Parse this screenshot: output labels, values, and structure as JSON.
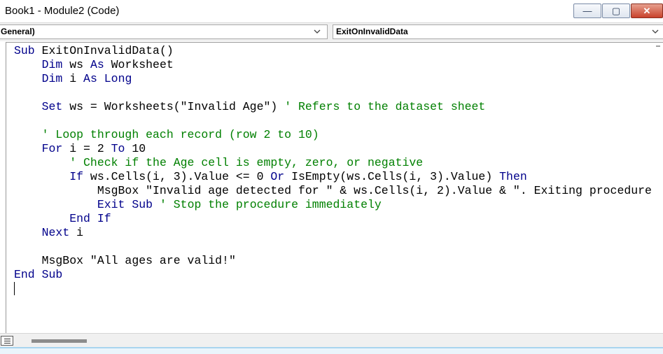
{
  "window": {
    "title": "Book1 - Module2 (Code)",
    "minimize_glyph": "—",
    "maximize_glyph": "▢",
    "close_glyph": "✕"
  },
  "object_combo": {
    "value": "(General)",
    "visible_text": "General)"
  },
  "procedure_combo": {
    "value": "ExitOnInvalidData"
  },
  "code_lines": [
    [
      {
        "t": "Sub",
        "c": "kw"
      },
      {
        "t": " ExitOnInvalidData()",
        "c": ""
      }
    ],
    [
      {
        "t": "    ",
        "c": ""
      },
      {
        "t": "Dim",
        "c": "kw"
      },
      {
        "t": " ws ",
        "c": ""
      },
      {
        "t": "As",
        "c": "kw"
      },
      {
        "t": " Worksheet",
        "c": ""
      }
    ],
    [
      {
        "t": "    ",
        "c": ""
      },
      {
        "t": "Dim",
        "c": "kw"
      },
      {
        "t": " i ",
        "c": ""
      },
      {
        "t": "As",
        "c": "kw"
      },
      {
        "t": " ",
        "c": ""
      },
      {
        "t": "Long",
        "c": "kw"
      }
    ],
    [],
    [
      {
        "t": "    ",
        "c": ""
      },
      {
        "t": "Set",
        "c": "kw"
      },
      {
        "t": " ws = Worksheets(\"Invalid Age\") ",
        "c": ""
      },
      {
        "t": "' Refers to the dataset sheet",
        "c": "cm"
      }
    ],
    [],
    [
      {
        "t": "    ",
        "c": ""
      },
      {
        "t": "' Loop through each record (row 2 to 10)",
        "c": "cm"
      }
    ],
    [
      {
        "t": "    ",
        "c": ""
      },
      {
        "t": "For",
        "c": "kw"
      },
      {
        "t": " i = 2 ",
        "c": ""
      },
      {
        "t": "To",
        "c": "kw"
      },
      {
        "t": " 10",
        "c": ""
      }
    ],
    [
      {
        "t": "        ",
        "c": ""
      },
      {
        "t": "' Check if the Age cell is empty, zero, or negative",
        "c": "cm"
      }
    ],
    [
      {
        "t": "        ",
        "c": ""
      },
      {
        "t": "If",
        "c": "kw"
      },
      {
        "t": " ws.Cells(i, 3).Value <= 0 ",
        "c": ""
      },
      {
        "t": "Or",
        "c": "kw"
      },
      {
        "t": " IsEmpty(ws.Cells(i, 3).Value) ",
        "c": ""
      },
      {
        "t": "Then",
        "c": "kw"
      }
    ],
    [
      {
        "t": "            MsgBox \"Invalid age detected for \" & ws.Cells(i, 2).Value & \". Exiting procedure",
        "c": ""
      }
    ],
    [
      {
        "t": "            ",
        "c": ""
      },
      {
        "t": "Exit",
        "c": "kw"
      },
      {
        "t": " ",
        "c": ""
      },
      {
        "t": "Sub",
        "c": "kw"
      },
      {
        "t": " ",
        "c": ""
      },
      {
        "t": "' Stop the procedure immediately",
        "c": "cm"
      }
    ],
    [
      {
        "t": "        ",
        "c": ""
      },
      {
        "t": "End",
        "c": "kw"
      },
      {
        "t": " ",
        "c": ""
      },
      {
        "t": "If",
        "c": "kw"
      }
    ],
    [
      {
        "t": "    ",
        "c": ""
      },
      {
        "t": "Next",
        "c": "kw"
      },
      {
        "t": " i",
        "c": ""
      }
    ],
    [],
    [
      {
        "t": "    MsgBox \"All ages are valid!\"",
        "c": ""
      }
    ],
    [
      {
        "t": "End",
        "c": "kw"
      },
      {
        "t": " ",
        "c": ""
      },
      {
        "t": "Sub",
        "c": "kw"
      }
    ]
  ],
  "colors": {
    "keyword": "#00008b",
    "comment": "#008000",
    "text": "#000000"
  }
}
